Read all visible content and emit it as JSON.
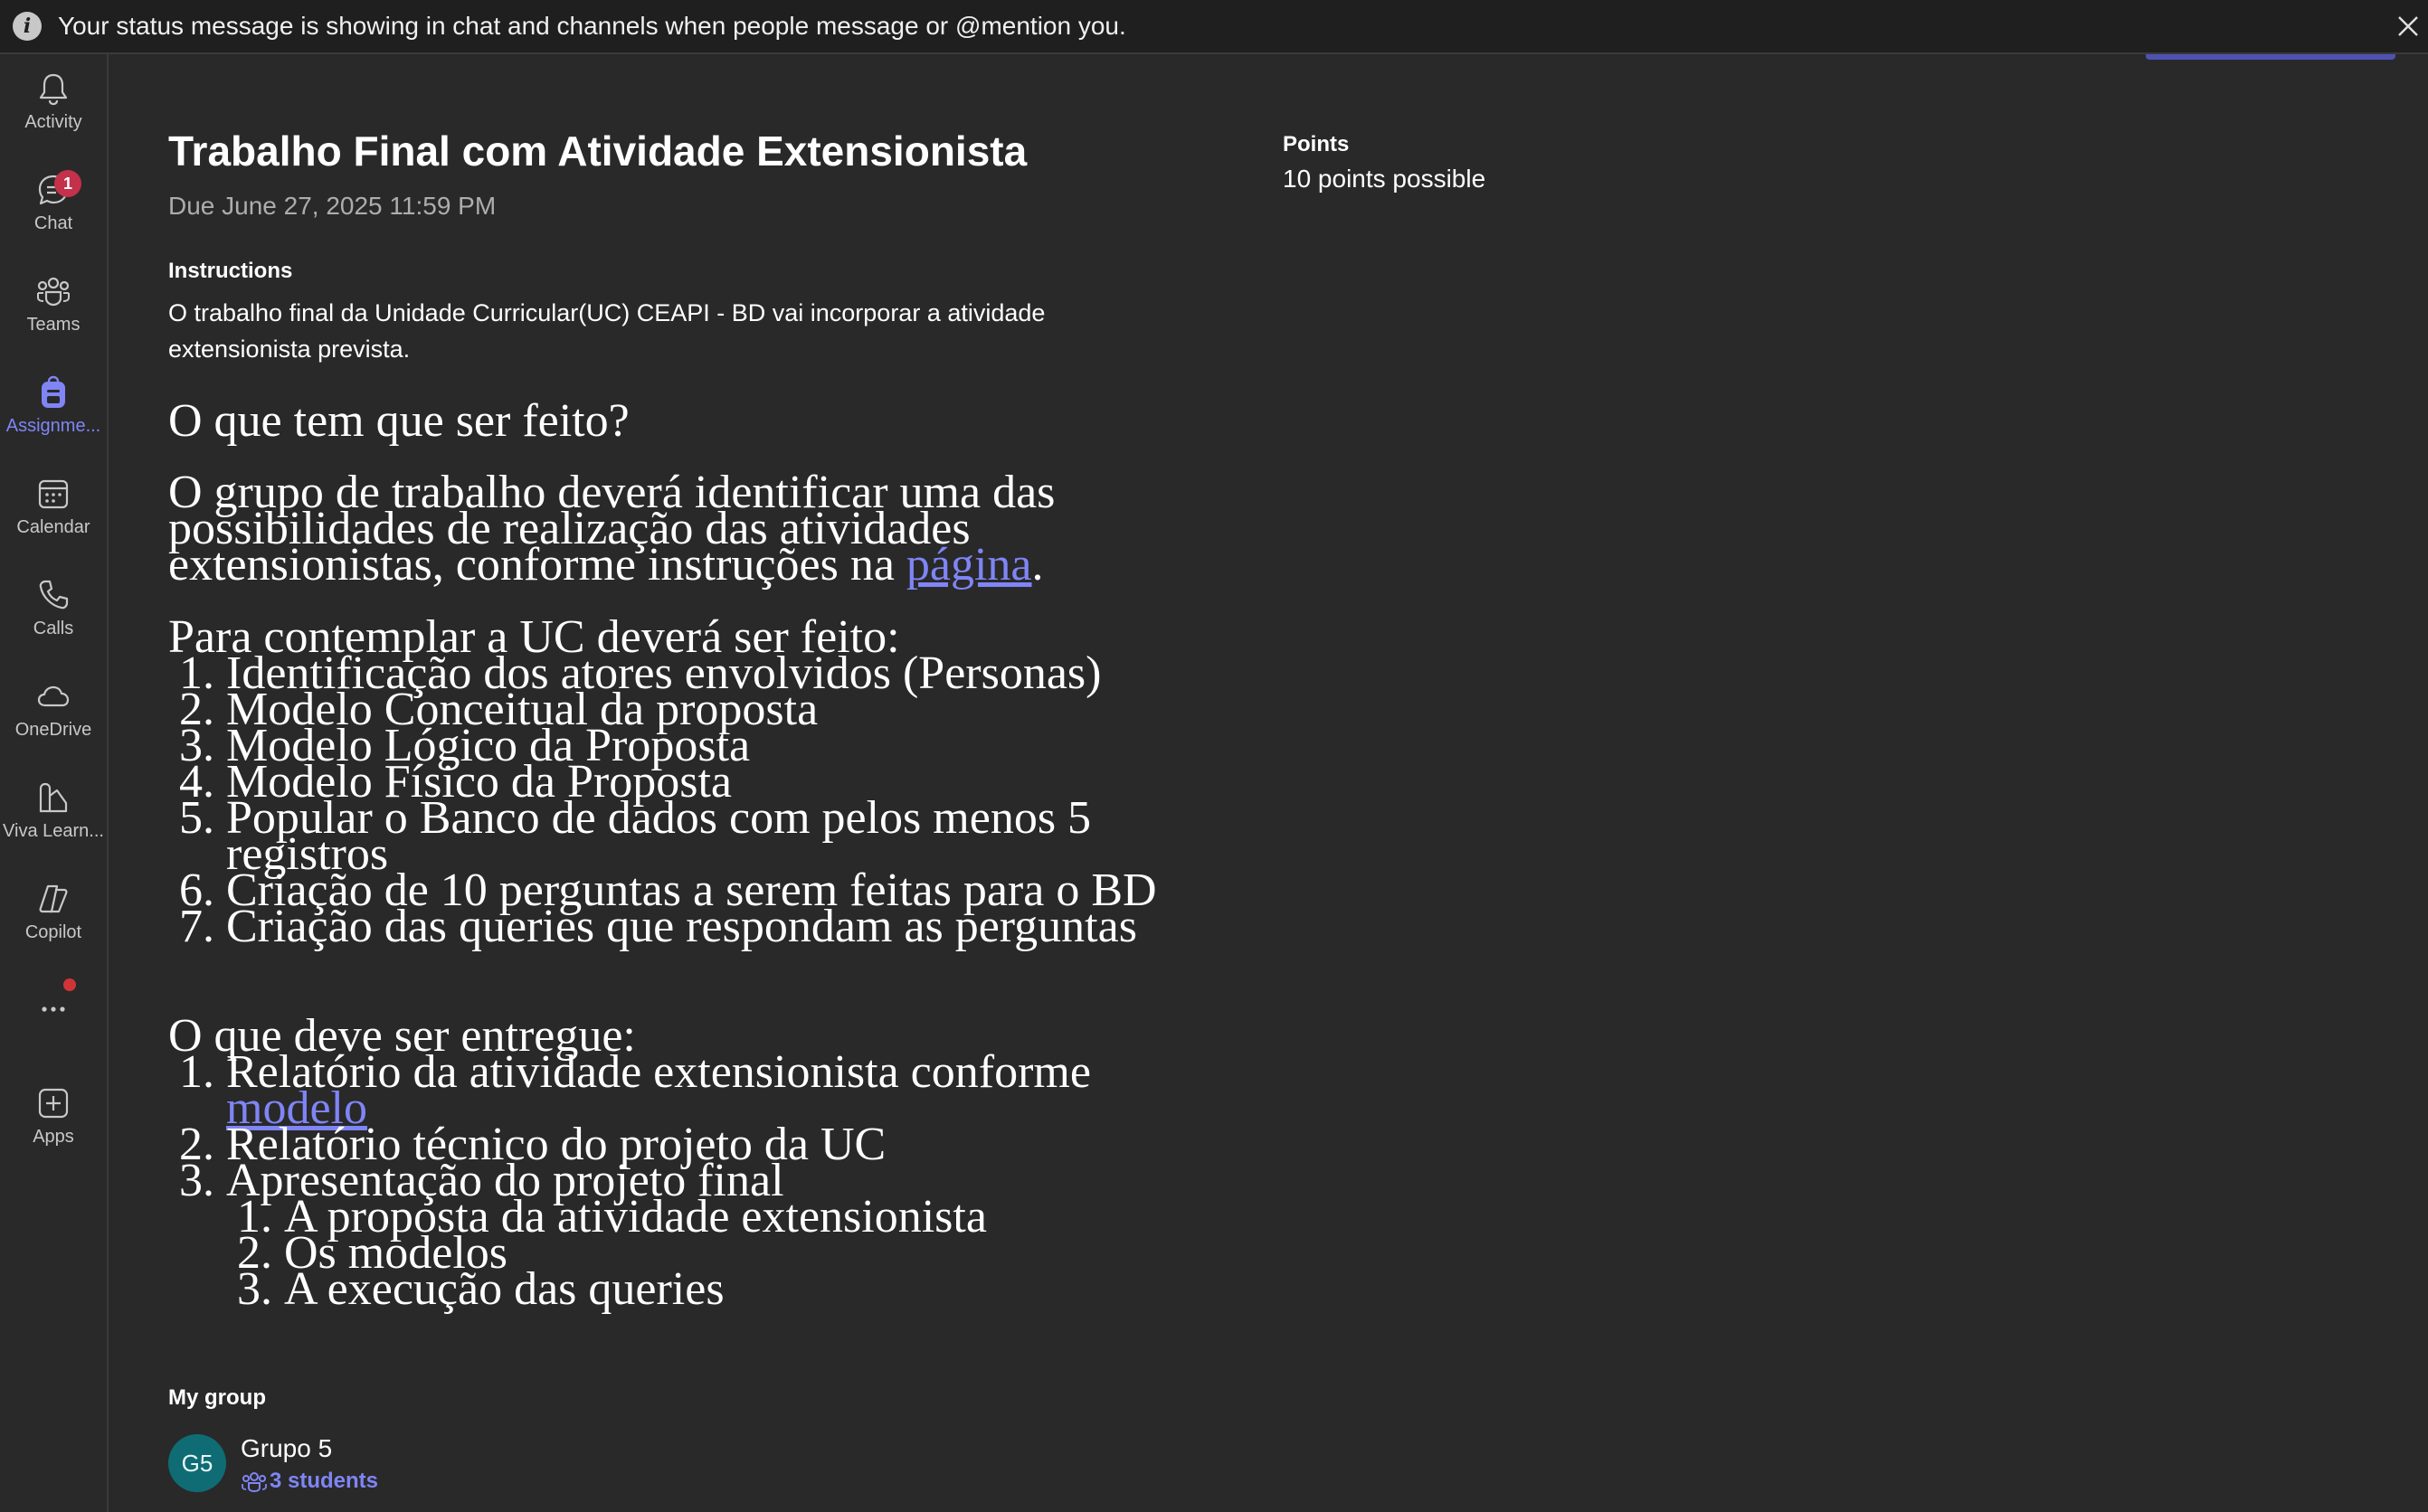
{
  "banner": {
    "message": "Your status message is showing in chat and channels when people message or @mention you."
  },
  "rail": {
    "items": [
      {
        "label": "Activity",
        "icon": "bell-icon"
      },
      {
        "label": "Chat",
        "icon": "chat-icon",
        "badge": "1"
      },
      {
        "label": "Teams",
        "icon": "teams-icon"
      },
      {
        "label": "Assignme...",
        "icon": "backpack-icon",
        "active": true
      },
      {
        "label": "Calendar",
        "icon": "calendar-icon"
      },
      {
        "label": "Calls",
        "icon": "phone-icon"
      },
      {
        "label": "OneDrive",
        "icon": "cloud-icon"
      },
      {
        "label": "Viva Learn...",
        "icon": "books-icon"
      },
      {
        "label": "Copilot",
        "icon": "copilot-icon"
      },
      {
        "label": "",
        "icon": "more-icon"
      },
      {
        "label": "Apps",
        "icon": "add-apps-icon"
      }
    ]
  },
  "assignment": {
    "title": "Trabalho Final com Atividade Extensionista",
    "due": "Due June 27, 2025 11:59 PM",
    "instructions_heading": "Instructions",
    "instructions_text": "O trabalho final da Unidade Curricular(UC) CEAPI - BD vai incorporar a atividade extensionista prevista.",
    "section1_heading": "O que tem que ser feito?",
    "section1_para_before_link": "O grupo de trabalho deverá identificar uma das possibilidades de realização das atividades extensionistas, conforme instruções na ",
    "section1_link": "página",
    "section1_para_after_link": ".",
    "section2_heading": "Para contemplar a UC deverá ser feito:",
    "section2_items": [
      "Identificação dos atores envolvidos (Personas)",
      "Modelo Conceitual da proposta",
      "Modelo Lógico da Proposta",
      "Modelo Físico da Proposta",
      "Popular o Banco de dados com pelos menos 5 registros",
      "Criação de 10 perguntas a serem feitas para o BD",
      "Criação das queries que respondam as perguntas"
    ],
    "section3_heading": "O que deve ser entregue:",
    "section3_item1_text": "Relatório da atividade extensionista conforme ",
    "section3_item1_link": "modelo",
    "section3_item2": "Relatório técnico do projeto da UC",
    "section3_item3": "Apresentação do projeto final",
    "section3_subitems": [
      "A proposta da atividade extensionista",
      "Os modelos",
      "A execução das queries"
    ]
  },
  "points": {
    "heading": "Points",
    "value": "10 points possible"
  },
  "group": {
    "heading": "My group",
    "initials": "G5",
    "name": "Grupo 5",
    "students": "3 students"
  },
  "colors": {
    "accent": "#7f85f5",
    "background": "#292929",
    "badge": "#c4314b",
    "avatar": "#0f6c74"
  }
}
